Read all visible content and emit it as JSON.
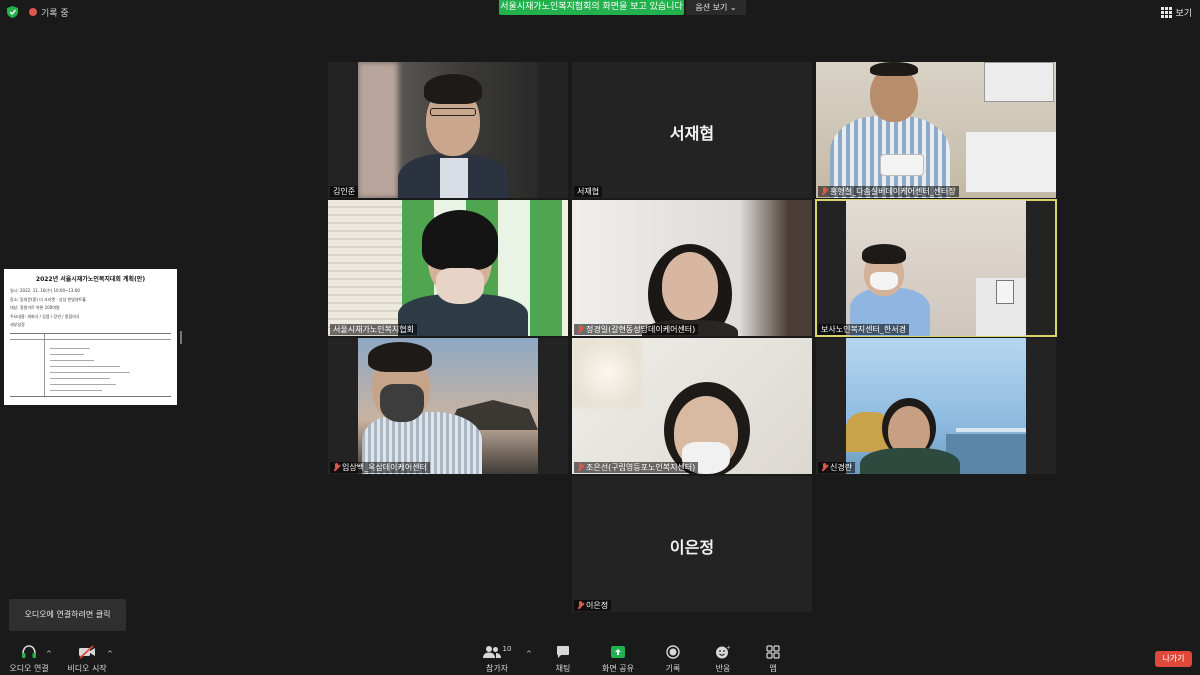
{
  "top_bar": {
    "recording_label": "기록 중",
    "share_banner": "서울시재가노인복지협회의 화면을 보고 있습니다",
    "view_options_label": "옵션 보기",
    "view_button_label": "보기"
  },
  "shared_doc": {
    "title": "2022년 서울시재가노인복지대회 계획(안)",
    "lines": [
      "일시: 2022. 11. 16(수) 10:00~13:00",
      "장소: 동대문(종) 더 크리켓 · 상상 한빛센트홀",
      "대상: 종원가르 약론 100여명",
      "주요내용: 개회식 / 강용 / 강연 / 종합의식",
      "세부일정"
    ]
  },
  "participants": [
    {
      "name": "김인준",
      "muted": false
    },
    {
      "name": "서재협",
      "muted": false,
      "video_off": true
    },
    {
      "name": "홍형철_다솜실버데이케어센터_센터장",
      "muted": true
    },
    {
      "name": "서울시재가노인복지협회",
      "muted": false
    },
    {
      "name": "정경일(갈현동성당데이케어센터)",
      "muted": true
    },
    {
      "name": "보사노인복지센터_한서경",
      "muted": false,
      "active_speaker": true
    },
    {
      "name": "임상백_옥삼데이케어센터",
      "muted": true
    },
    {
      "name": "조은선(구립영등포노인복지센터)",
      "muted": true
    },
    {
      "name": "신경란",
      "muted": true
    },
    {
      "name": "이은정",
      "muted": true,
      "video_off": true
    }
  ],
  "audio_tooltip": "오디오에 연결하려면 클릭",
  "toolbar": {
    "audio_label": "오디오 연결",
    "video_label": "비디오 시작",
    "participants_label": "참가자",
    "participants_count": "10",
    "chat_label": "채팅",
    "share_label": "화면 공유",
    "record_label": "기록",
    "reactions_label": "반응",
    "apps_label": "앱",
    "leave_label": "나가기"
  },
  "colors": {
    "background": "#1a1a1a",
    "share_green": "#23b14d",
    "leave_red": "#e0483c",
    "active_speaker_outline": "#d8d66a"
  }
}
